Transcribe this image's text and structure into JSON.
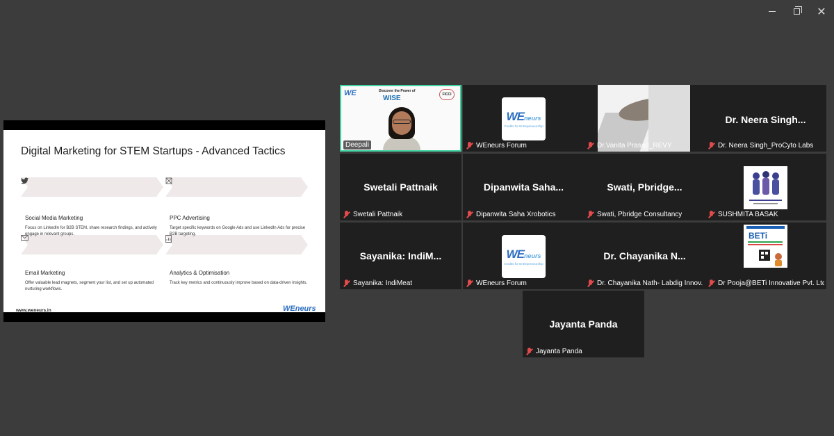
{
  "slide": {
    "title": "Digital Marketing for STEM Startups - Advanced Tactics",
    "sections": [
      {
        "icon": "twitter-icon",
        "heading": "Social Media Marketing",
        "text": "Focus on LinkedIn for B2B STEM, share research findings, and actively engage in relevant groups."
      },
      {
        "icon": "mouse-pointer-icon",
        "heading": "PPC Advertising",
        "text": "Target specific keywords on Google Ads and use LinkedIn Ads for precise B2B targeting."
      },
      {
        "icon": "mail-icon",
        "heading": "Email Marketing",
        "text": "Offer valuable lead magnets, segment your list, and set up automated nurturing workflows."
      },
      {
        "icon": "chart-icon",
        "heading": "Analytics & Optimisation",
        "text": "Track key metrics and continuously improve based on data-driven insights."
      }
    ],
    "url": "www.weneurs.in",
    "logo": "WEneurs"
  },
  "participants": [
    {
      "label": "Deepali",
      "tile_text": ""
    },
    {
      "label": "WEneurs Forum",
      "tile_text": ""
    },
    {
      "label": "Dr.Vanita Prasad_REVY",
      "tile_text": ""
    },
    {
      "label": "Dr. Neera Singh_ProCyto Labs",
      "tile_text": "Dr. Neera Singh..."
    },
    {
      "label": "Swetali Pattnaik",
      "tile_text": "Swetali Pattnaik"
    },
    {
      "label": "Dipanwita Saha Xrobotics",
      "tile_text": "Dipanwita Saha..."
    },
    {
      "label": "Swati, Pbridge Consultancy",
      "tile_text": "Swati, Pbridge..."
    },
    {
      "label": "SUSHMITA BASAK",
      "tile_text": ""
    },
    {
      "label": "Sayanika: IndiMeat",
      "tile_text": "Sayanika: IndiM..."
    },
    {
      "label": "WEneurs Forum",
      "tile_text": ""
    },
    {
      "label": "Dr. Chayanika Nath- Labdig Innov...",
      "tile_text": "Dr. Chayanika N..."
    },
    {
      "label": "Dr Pooja@BETi Innovative Pvt. Ltd.",
      "tile_text": ""
    },
    {
      "label": "Jayanta Panda",
      "tile_text": "Jayanta Panda"
    }
  ],
  "brand": {
    "we_logo": "WE",
    "we_logo_suffix": "neurs",
    "we_tagline": "Credits for Entrepreneurship",
    "wise_title": "Discover the Power of",
    "wise_word": "WISE",
    "ficci": "FICCI",
    "beti": "BETi"
  },
  "colors": {
    "background": "#3c3c3c",
    "tile": "#1f1f1f",
    "active_border": "#3fd3a0",
    "muted_mic": "#e04a4a"
  }
}
